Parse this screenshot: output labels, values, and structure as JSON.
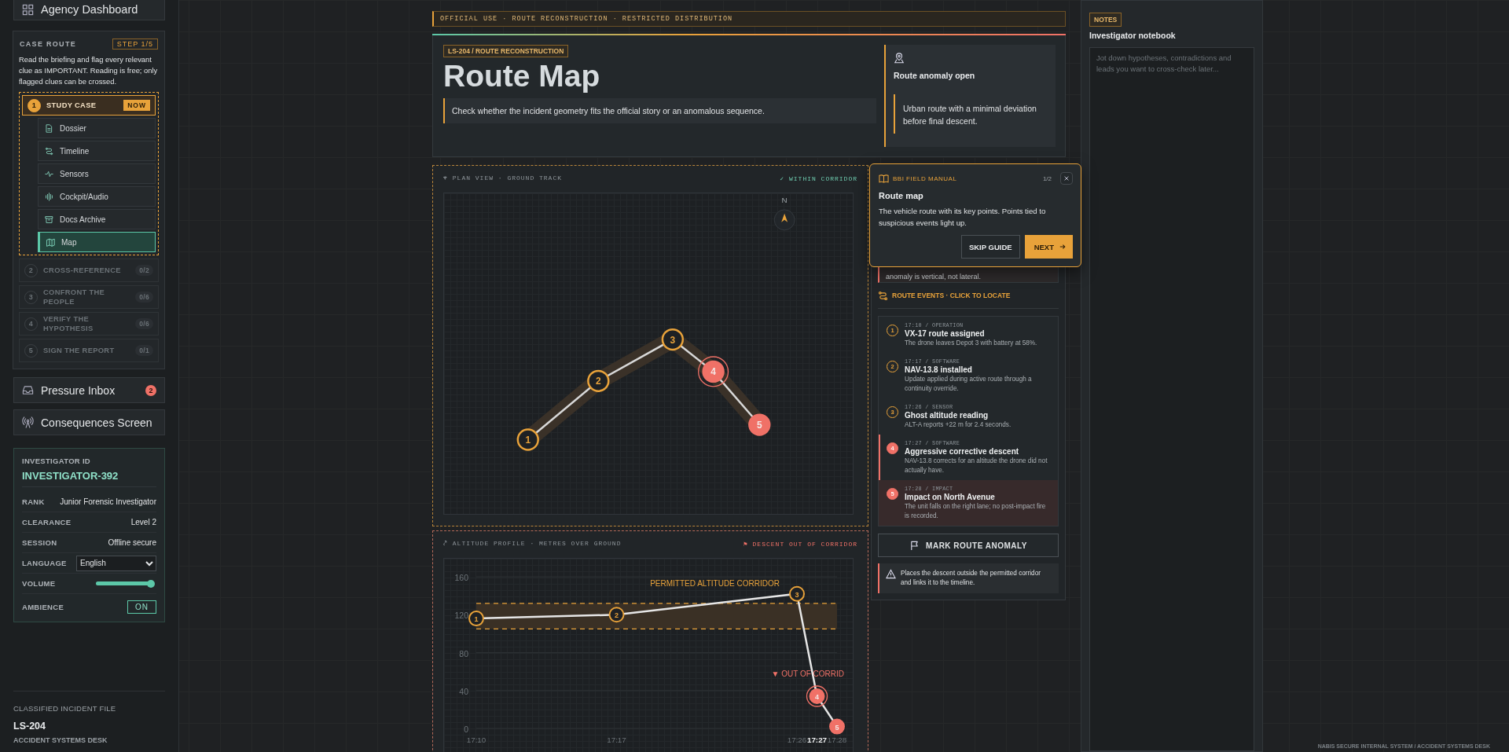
{
  "sidebar": {
    "dashboard_link": "Agency Dashboard",
    "case_route": {
      "title": "CASE ROUTE",
      "step": "STEP 1/5",
      "instructions": "Read the briefing and flag every relevant clue as IMPORTANT. Reading is free; only flagged clues can be crossed.",
      "steps": [
        {
          "number": "1",
          "label": "STUDY CASE",
          "badge": "NOW",
          "selected": true,
          "expanded": true,
          "children": [
            {
              "label": "Dossier",
              "selected": false
            },
            {
              "label": "Timeline",
              "selected": false
            },
            {
              "label": "Sensors",
              "selected": false
            },
            {
              "label": "Cockpit/Audio",
              "selected": false
            },
            {
              "label": "Docs Archive",
              "selected": false
            },
            {
              "label": "Map",
              "selected": true
            }
          ]
        },
        {
          "number": "2",
          "label": "CROSS-REFERENCE",
          "count": "0/2",
          "selected": false,
          "expanded": false
        },
        {
          "number": "3",
          "label": "CONFRONT THE PEOPLE",
          "count": "0/6",
          "selected": false,
          "expanded": false
        },
        {
          "number": "4",
          "label": "VERIFY THE HYPOTHESIS",
          "count": "0/6",
          "selected": false,
          "expanded": false
        },
        {
          "number": "5",
          "label": "SIGN THE REPORT",
          "count": "0/1",
          "selected": false,
          "expanded": false
        }
      ]
    },
    "nav": [
      {
        "label": "Pressure Inbox",
        "badge": "2"
      },
      {
        "label": "Consequences Screen"
      }
    ],
    "investigator": {
      "id_label": "INVESTIGATOR ID",
      "id": "INVESTIGATOR-392",
      "fields": [
        {
          "label": "RANK",
          "value": "Junior Forensic Investigator"
        },
        {
          "label": "CLEARANCE",
          "value": "Level 2"
        },
        {
          "label": "SESSION",
          "value": "Offline secure"
        }
      ],
      "language": {
        "label": "LANGUAGE",
        "value": "English"
      },
      "volume": {
        "label": "VOLUME",
        "level": 0.95
      },
      "ambience": {
        "label": "AMBIENCE",
        "value": "ON",
        "on": true
      }
    },
    "footer": {
      "caption": "CLASSIFIED INCIDENT FILE",
      "case": "LS-204",
      "desk": "ACCIDENT SYSTEMS DESK"
    }
  },
  "banner": "OFFICIAL USE · ROUTE RECONSTRUCTION · RESTRICTED DISTRIBUTION",
  "header": {
    "tag": "LS-204 / ROUTE RECONSTRUCTION",
    "title": "Route Map",
    "lead": "Check whether the incident geometry fits the official story or an anomalous sequence.",
    "status": {
      "title": "Route anomaly open",
      "note": "Urban route with a minimal deviation before final descent."
    }
  },
  "plan_view": {
    "title": "⌖ PLAN VIEW · GROUND TRACK",
    "status": "✓ WITHIN CORRIDOR",
    "compass": "N",
    "points": [
      {
        "label": "1",
        "suspicious": false,
        "selected": false
      },
      {
        "label": "2",
        "suspicious": false,
        "selected": false
      },
      {
        "label": "3",
        "suspicious": false,
        "selected": false
      },
      {
        "label": "4",
        "suspicious": true,
        "selected": true
      },
      {
        "label": "5",
        "suspicious": true,
        "selected": false
      }
    ]
  },
  "altitude": {
    "title": "⤤ ALTITUDE PROFILE · METRES OVER GROUND",
    "status": "⚑ DESCENT OUT OF CORRIDOR",
    "markers": [
      {
        "label": "1",
        "suspicious": false,
        "selected": false
      },
      {
        "label": "2",
        "suspicious": false,
        "selected": false
      },
      {
        "label": "3",
        "suspicious": false,
        "selected": false
      },
      {
        "label": "4",
        "suspicious": true,
        "selected": true
      },
      {
        "label": "5",
        "suspicious": true,
        "selected": false
      }
    ],
    "chart_data": {
      "type": "line",
      "categories": [
        "17:10",
        "17:17",
        "17:26",
        "17:27",
        "17:28"
      ],
      "values": [
        116,
        120,
        142,
        34,
        2
      ],
      "marker": true,
      "ylim": [
        0,
        160
      ],
      "yticks": [
        0,
        40,
        80,
        120,
        160
      ],
      "bands": [
        {
          "axis": "y",
          "from": 105,
          "to": 132,
          "label": "PERMITTED ALTITUDE CORRIDOR"
        }
      ],
      "ref_lines": [
        {
          "axis": "y",
          "value": 105
        },
        {
          "axis": "y",
          "value": 132
        }
      ],
      "annotations": [
        {
          "text": "▼ OUT OF CORRID",
          "x": "17:27",
          "y": 55
        }
      ]
    }
  },
  "route_panel": {
    "hidden_note": "anomaly is vertical, not lateral.",
    "events_title": "ROUTE EVENTS · CLICK TO LOCATE",
    "events": [
      {
        "number": "1",
        "meta": "17:10 / OPERATION",
        "title": "VX-17 route assigned",
        "text": "The drone leaves Depot 3 with battery at 58%.",
        "suspicious": false,
        "selected": false,
        "highlighted": false
      },
      {
        "number": "2",
        "meta": "17:17 / SOFTWARE",
        "title": "NAV-13.8 installed",
        "text": "Update applied during active route through a continuity override.",
        "suspicious": false,
        "selected": false,
        "highlighted": false
      },
      {
        "number": "3",
        "meta": "17:26 / SENSOR",
        "title": "Ghost altitude reading",
        "text": "ALT-A reports +22 m for 2.4 seconds.",
        "suspicious": false,
        "selected": false,
        "highlighted": false
      },
      {
        "number": "4",
        "meta": "17:27 / SOFTWARE",
        "title": "Aggressive corrective descent",
        "text": "NAV-13.8 corrects for an altitude the drone did not actually have.",
        "suspicious": true,
        "selected": true,
        "highlighted": false
      },
      {
        "number": "5",
        "meta": "17:28 / IMPACT",
        "title": "Impact on North Avenue",
        "text": "The unit falls on the right lane; no post-impact fire is recorded.",
        "suspicious": true,
        "selected": false,
        "highlighted": true
      }
    ],
    "action": "MARK ROUTE ANOMALY",
    "warning": "Places the descent outside the permitted corridor and links it to the timeline."
  },
  "guide": {
    "source": "BBI FIELD MANUAL",
    "page": "1/2",
    "title": "Route map",
    "text": "The vehicle route with its key points. Points tied to suspicious events light up.",
    "skip": "SKIP GUIDE",
    "next": "NEXT"
  },
  "notes": {
    "tag": "NOTES",
    "title": "Investigator notebook",
    "placeholder": "Jot down hypotheses, contradictions and leads you want to cross-check later..."
  },
  "system_mark": "NABIS SECURE INTERNAL SYSTEM / ACCIDENT SYSTEMS DESK"
}
